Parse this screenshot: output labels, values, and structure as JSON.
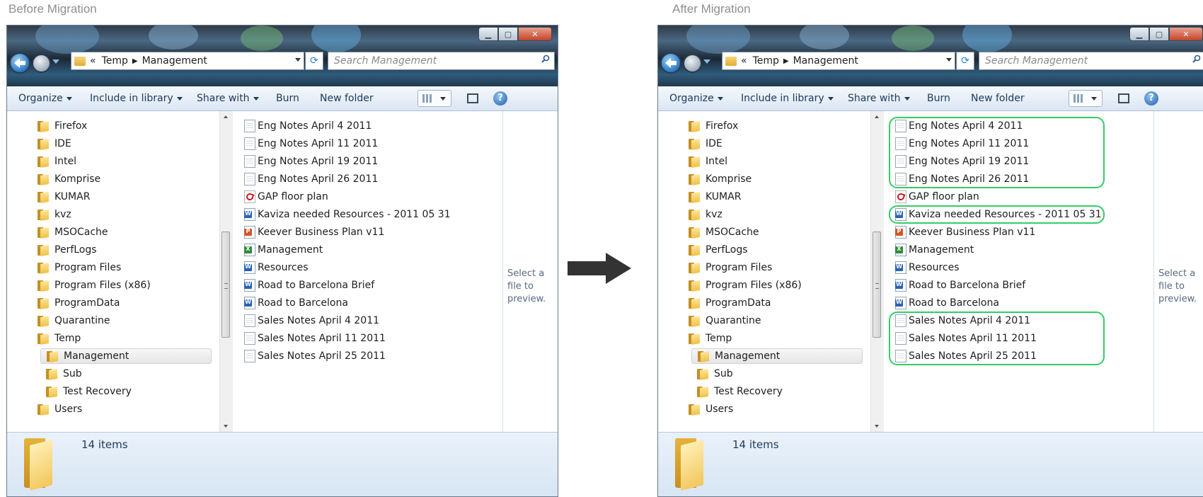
{
  "captions": {
    "before": "Before Migration",
    "after": "After Migration"
  },
  "window": {
    "address": {
      "overflow": "«",
      "parent": "Temp",
      "current": "Management"
    },
    "search_placeholder": "Search Management",
    "toolbar": {
      "organize": "Organize",
      "include_in_library": "Include in library",
      "share_with": "Share with",
      "burn": "Burn",
      "new_folder": "New folder"
    },
    "tree": [
      {
        "label": "Firefox",
        "level": 0
      },
      {
        "label": "IDE",
        "level": 0
      },
      {
        "label": "Intel",
        "level": 0
      },
      {
        "label": "Komprise",
        "level": 0
      },
      {
        "label": "KUMAR",
        "level": 0
      },
      {
        "label": "kvz",
        "level": 0
      },
      {
        "label": "MSOCache",
        "level": 0
      },
      {
        "label": "PerfLogs",
        "level": 0
      },
      {
        "label": "Program Files",
        "level": 0
      },
      {
        "label": "Program Files (x86)",
        "level": 0
      },
      {
        "label": "ProgramData",
        "level": 0
      },
      {
        "label": "Quarantine",
        "level": 0
      },
      {
        "label": "Temp",
        "level": 0
      },
      {
        "label": "Management",
        "level": 1,
        "selected": true
      },
      {
        "label": "Sub",
        "level": 1
      },
      {
        "label": "Test Recovery",
        "level": 1
      },
      {
        "label": "Users",
        "level": 0
      }
    ],
    "files": [
      {
        "name": "Eng Notes April 4 2011",
        "type": "txt"
      },
      {
        "name": "Eng Notes April 11 2011",
        "type": "txt"
      },
      {
        "name": "Eng Notes April 19 2011",
        "type": "txt"
      },
      {
        "name": "Eng Notes April 26 2011",
        "type": "txt"
      },
      {
        "name": "GAP floor plan",
        "type": "pdf"
      },
      {
        "name": "Kaviza needed Resources - 2011 05 31",
        "type": "doc"
      },
      {
        "name": "Keever Business Plan v11",
        "type": "ppt"
      },
      {
        "name": "Management",
        "type": "xls"
      },
      {
        "name": "Resources",
        "type": "doc"
      },
      {
        "name": "Road to Barcelona Brief",
        "type": "doc"
      },
      {
        "name": "Road to Barcelona",
        "type": "doc"
      },
      {
        "name": "Sales Notes April 4 2011",
        "type": "txt"
      },
      {
        "name": "Sales Notes April 11 2011",
        "type": "txt"
      },
      {
        "name": "Sales Notes April 25 2011",
        "type": "txt"
      }
    ],
    "preview_message": "Select a file to preview.",
    "item_count": "14 items"
  },
  "highlighted_after_migration": [
    [
      "Eng Notes April 4 2011",
      "Eng Notes April 11 2011",
      "Eng Notes April 19 2011",
      "Eng Notes April 26 2011"
    ],
    [
      "Kaviza needed Resources - 2011 05 31"
    ],
    [
      "Sales Notes April 4 2011",
      "Sales Notes April 11 2011",
      "Sales Notes April 25 2011"
    ]
  ],
  "colors": {
    "highlight": "#33cc66",
    "arrow": "#333333",
    "caption": "#8f8f8f"
  }
}
